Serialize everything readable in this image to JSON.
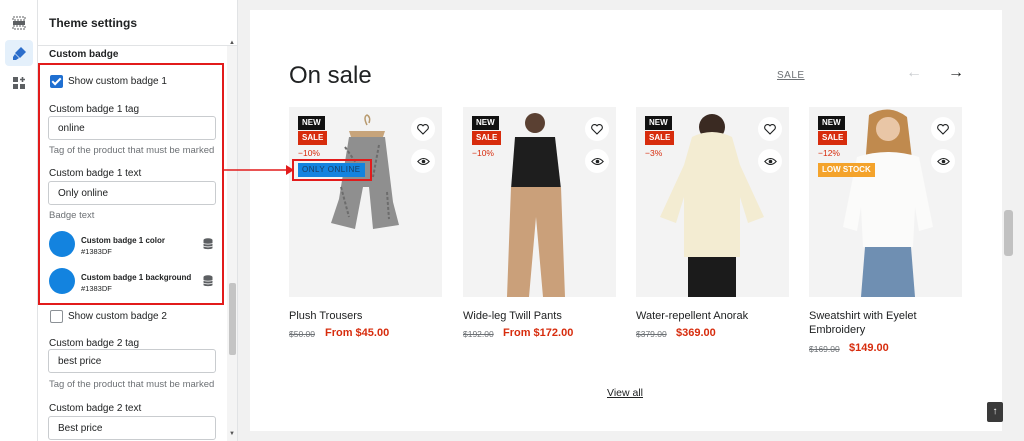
{
  "panel": {
    "title": "Theme settings",
    "section_title": "Custom badge",
    "badge1": {
      "checkbox_label": "Show custom badge 1",
      "checked": true,
      "tag_label": "Custom badge 1 tag",
      "tag_value": "online",
      "tag_help": "Tag of the product that must be marked",
      "text_label": "Custom badge 1 text",
      "text_value": "Only online",
      "text_help": "Badge text",
      "color_label": "Custom badge 1 color",
      "color_hex": "#1383DF",
      "bg_label": "Custom badge 1 background",
      "bg_hex": "#1383DF"
    },
    "badge2": {
      "checkbox_label": "Show custom badge 2",
      "checked": false,
      "tag_label": "Custom badge 2 tag",
      "tag_value": "best price",
      "tag_help": "Tag of the product that must be marked",
      "text_label": "Custom badge 2 text",
      "text_value": "Best price"
    }
  },
  "preview": {
    "section_title": "On sale",
    "sale_link": "SALE",
    "view_all": "View all",
    "products": [
      {
        "name": "Plush Trousers",
        "old_price": "$50.00",
        "new_price": "From $45.00",
        "badge_new": "NEW",
        "badge_sale": "SALE",
        "discount": "−10%",
        "extra_badge": "ONLY ONLINE"
      },
      {
        "name": "Wide-leg Twill Pants",
        "old_price": "$192.00",
        "new_price": "From $172.00",
        "badge_new": "NEW",
        "badge_sale": "SALE",
        "discount": "−10%"
      },
      {
        "name": "Water-repellent Anorak",
        "old_price": "$379.00",
        "new_price": "$369.00",
        "badge_new": "NEW",
        "badge_sale": "SALE",
        "discount": "−3%"
      },
      {
        "name": "Sweatshirt with Eyelet Embroidery",
        "old_price": "$169.00",
        "new_price": "$149.00",
        "badge_new": "NEW",
        "badge_sale": "SALE",
        "discount": "−12%",
        "extra_badge": "LOW STOCK"
      }
    ]
  },
  "colors": {
    "accent_red": "#d72c0d",
    "badge_blue": "#1383DF",
    "highlight": "#e21b1b",
    "low_stock": "#f4a32b"
  },
  "icons": [
    "sections-icon",
    "theme-settings-brush-icon",
    "app-blocks-icon",
    "heart-icon",
    "eye-icon",
    "database-icon",
    "arrow-left-icon",
    "arrow-right-icon",
    "arrow-up-icon"
  ]
}
